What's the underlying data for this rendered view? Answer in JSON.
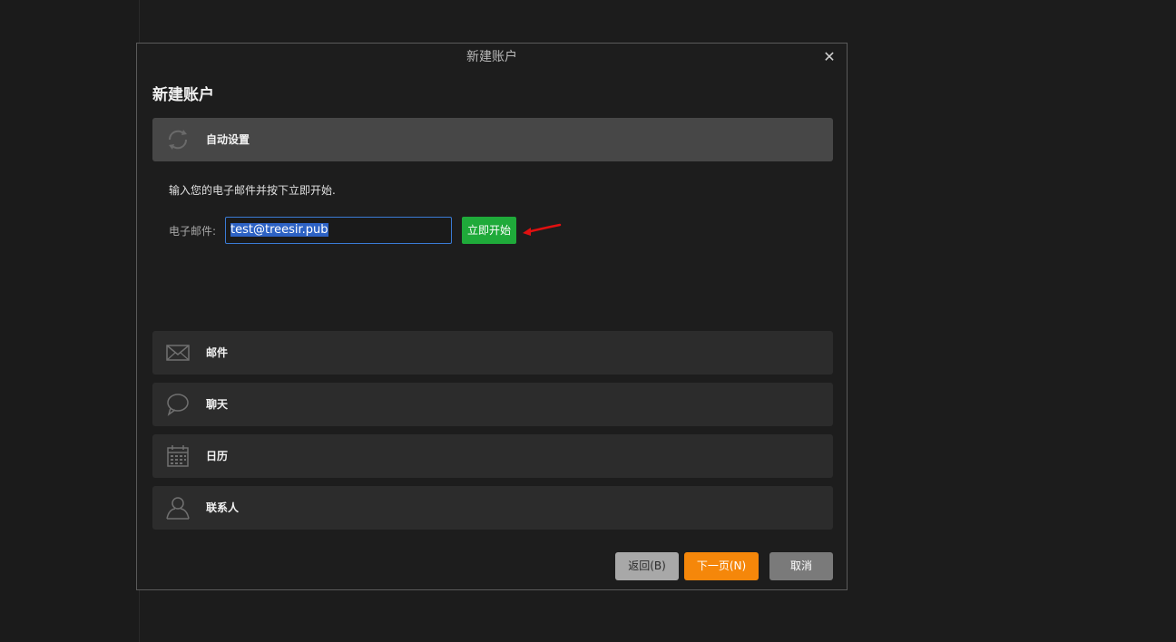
{
  "dialog": {
    "window_title": "新建账户",
    "heading": "新建账户",
    "close_glyph": "✕"
  },
  "sections": {
    "auto_setup": {
      "label": "自动设置",
      "icon": "sync-icon"
    },
    "mail": {
      "label": "邮件",
      "icon": "envelope-icon"
    },
    "chat": {
      "label": "聊天",
      "icon": "chat-bubble-icon"
    },
    "calendar": {
      "label": "日历",
      "icon": "calendar-icon"
    },
    "contacts": {
      "label": "联系人",
      "icon": "person-icon"
    }
  },
  "auto_setup": {
    "instruction": "输入您的电子邮件并按下立即开始.",
    "email_label": "电子邮件:",
    "email_value": "test@treesir.pub",
    "start_button": "立即开始"
  },
  "footer": {
    "back": "返回(B)",
    "next": "下一页(N)",
    "cancel": "取消"
  },
  "colors": {
    "start_button": "#1faa3a",
    "next_button": "#f5870a",
    "annotation_arrow": "#e01010"
  }
}
